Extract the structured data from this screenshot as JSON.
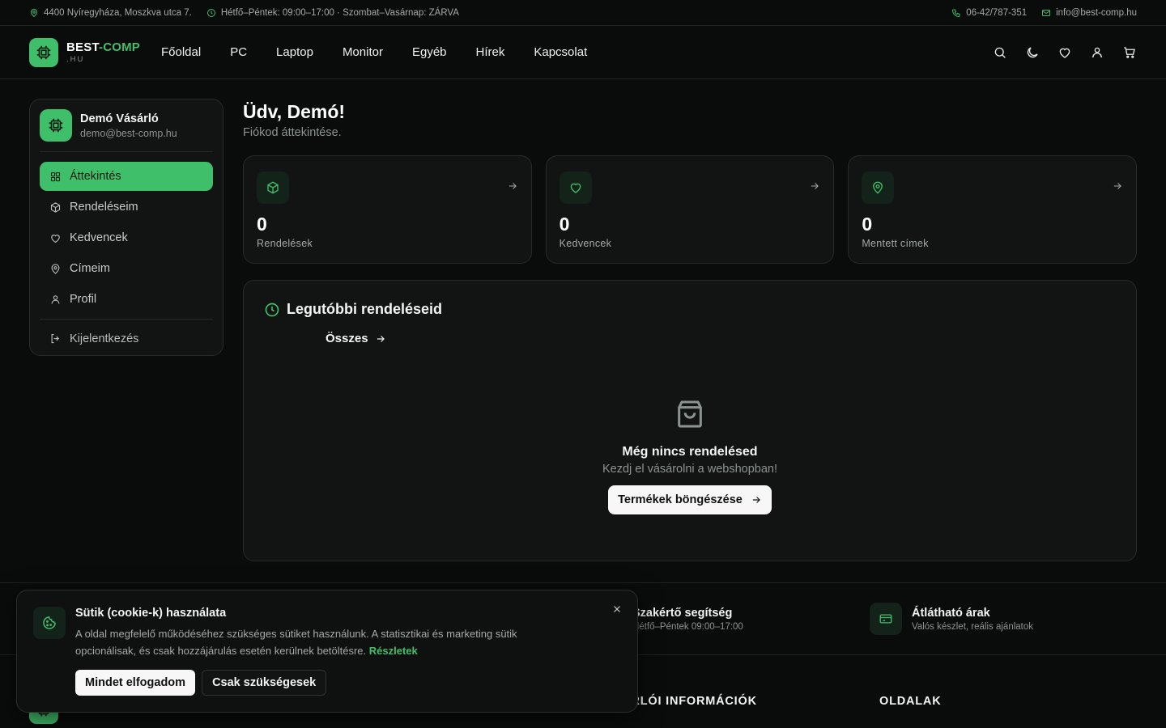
{
  "topbar": {
    "address": "4400 Nyíregyháza, Moszkva utca 7.",
    "hours": "Hétfő–Péntek: 09:00–17:00 · Szombat–Vasárnap: ZÁRVA",
    "phone": "06-42/787-351",
    "email": "info@best-comp.hu"
  },
  "brand": {
    "name_a": "BEST",
    "name_dash": "-",
    "name_b": "COMP",
    "tld": ".HU"
  },
  "nav": [
    "Főoldal",
    "PC",
    "Laptop",
    "Monitor",
    "Egyéb",
    "Hírek",
    "Kapcsolat"
  ],
  "header_icons": [
    "search-icon",
    "moon-icon",
    "heart-icon",
    "user-icon",
    "cart-icon"
  ],
  "user": {
    "name": "Demó Vásárló",
    "email": "demo@best-comp.hu"
  },
  "sidebar": {
    "items": [
      {
        "label": "Áttekintés",
        "icon": "grid-icon",
        "active": true
      },
      {
        "label": "Rendeléseim",
        "icon": "package-icon"
      },
      {
        "label": "Kedvencek",
        "icon": "heart-icon"
      },
      {
        "label": "Címeim",
        "icon": "map-pin-icon"
      },
      {
        "label": "Profil",
        "icon": "user-icon"
      }
    ],
    "logout": "Kijelentkezés"
  },
  "main": {
    "title": "Üdv, Demó!",
    "subtitle": "Fiókod áttekintése.",
    "stats": [
      {
        "value": "0",
        "label": "Rendelések",
        "icon": "package-icon"
      },
      {
        "value": "0",
        "label": "Kedvencek",
        "icon": "heart-icon"
      },
      {
        "value": "0",
        "label": "Mentett címek",
        "icon": "map-pin-icon"
      }
    ],
    "orders": {
      "title": "Legutóbbi rendeléseid",
      "all_link": "Összes",
      "empty_title": "Még nincs rendelésed",
      "empty_text": "Kezdj el vásárolni a webshopban!",
      "browse_button": "Termékek böngészése"
    }
  },
  "features": [
    {
      "title": "Szakértő segítség",
      "subtitle": "Hétfő–Péntek 09:00–17:00"
    },
    {
      "title": "Átlátható árak",
      "subtitle": "Valós készlet, reális ajánlatok"
    }
  ],
  "footer": {
    "col_info": "VÁSÁRLÓI INFORMÁCIÓK",
    "col_pages": "OLDALAK"
  },
  "cookie": {
    "title": "Sütik (cookie-k) használata",
    "text": "A oldal megfelelő működéséhez szükséges sütiket használunk. A statisztikai és marketing sütik opcionálisak, és csak hozzájárulás esetén kerülnek betöltésre.",
    "details_link": "Részletek",
    "accept_all": "Mindet elfogadom",
    "necessary_only": "Csak szükségesek"
  },
  "colors": {
    "accent": "#3fbf6a",
    "background": "#0a0b0b",
    "card": "#121414"
  }
}
